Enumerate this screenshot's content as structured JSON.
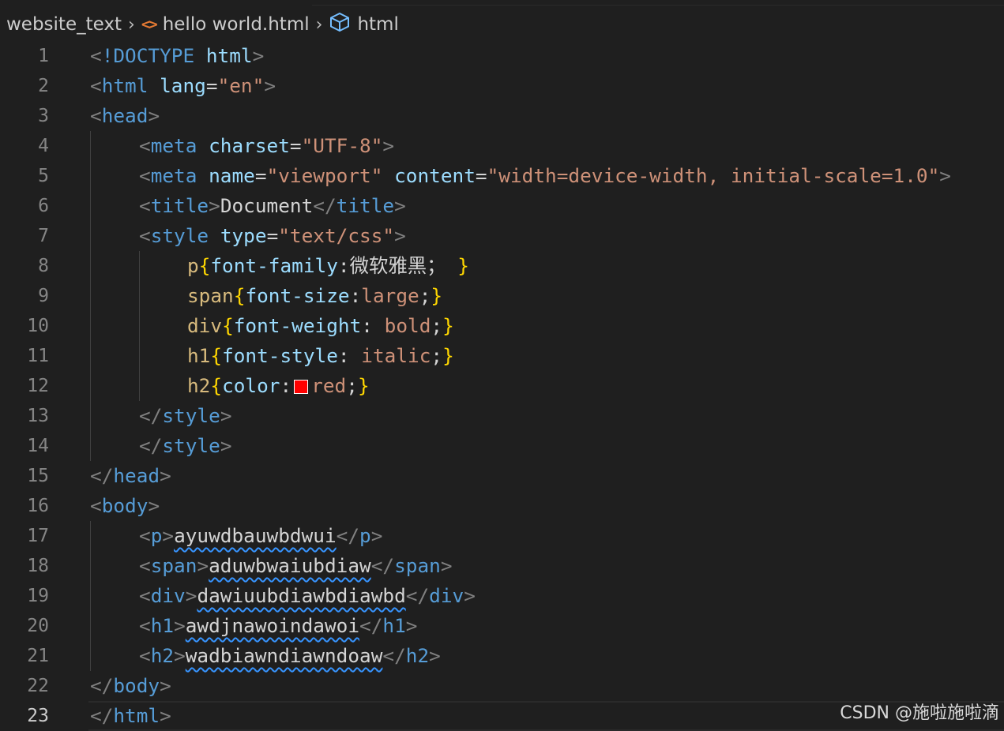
{
  "breadcrumb": {
    "folder": "website_text",
    "file": "hello world.html",
    "symbol": "html",
    "file_icon": "code-brackets-icon",
    "symbol_icon": "cube-icon"
  },
  "editor": {
    "active_line": 23,
    "colors": {
      "background": "#1f1f1f",
      "tag": "#569cd6",
      "attribute": "#9cdcfe",
      "string": "#ce9178",
      "selector": "#d7ba7d",
      "bracket": "#ffd700",
      "swatch": "#ff0000"
    },
    "lines": [
      {
        "n": "1",
        "indent": 0,
        "tokens": [
          [
            "p",
            "<"
          ],
          [
            "doc",
            "!DOCTYPE"
          ],
          [
            "ws",
            " "
          ],
          [
            "attr",
            "html"
          ],
          [
            "p",
            ">"
          ]
        ]
      },
      {
        "n": "2",
        "indent": 0,
        "tokens": [
          [
            "p",
            "<"
          ],
          [
            "tag",
            "html"
          ],
          [
            "ws",
            " "
          ],
          [
            "attr",
            "lang"
          ],
          [
            "txt",
            "="
          ],
          [
            "str",
            "\"en\""
          ],
          [
            "p",
            ">"
          ]
        ]
      },
      {
        "n": "3",
        "indent": 0,
        "tokens": [
          [
            "p",
            "<"
          ],
          [
            "tag",
            "head"
          ],
          [
            "p",
            ">"
          ]
        ]
      },
      {
        "n": "4",
        "indent": 1,
        "tokens": [
          [
            "p",
            "<"
          ],
          [
            "tag",
            "meta"
          ],
          [
            "ws",
            " "
          ],
          [
            "attr",
            "charset"
          ],
          [
            "txt",
            "="
          ],
          [
            "str",
            "\"UTF-8\""
          ],
          [
            "p",
            ">"
          ]
        ]
      },
      {
        "n": "5",
        "indent": 1,
        "tokens": [
          [
            "p",
            "<"
          ],
          [
            "tag",
            "meta"
          ],
          [
            "ws",
            " "
          ],
          [
            "attr",
            "name"
          ],
          [
            "txt",
            "="
          ],
          [
            "str",
            "\"viewport\""
          ],
          [
            "ws",
            " "
          ],
          [
            "attr",
            "content"
          ],
          [
            "txt",
            "="
          ],
          [
            "str",
            "\"width=device-width, initial-scale=1.0\""
          ],
          [
            "p",
            ">"
          ]
        ]
      },
      {
        "n": "6",
        "indent": 1,
        "tokens": [
          [
            "p",
            "<"
          ],
          [
            "tag",
            "title"
          ],
          [
            "p",
            ">"
          ],
          [
            "txt",
            "Document"
          ],
          [
            "p",
            "</"
          ],
          [
            "tag",
            "title"
          ],
          [
            "p",
            ">"
          ]
        ]
      },
      {
        "n": "7",
        "indent": 1,
        "tokens": [
          [
            "p",
            "<"
          ],
          [
            "tag",
            "style"
          ],
          [
            "ws",
            " "
          ],
          [
            "attr",
            "type"
          ],
          [
            "txt",
            "="
          ],
          [
            "str",
            "\"text/css\""
          ],
          [
            "p",
            ">"
          ]
        ]
      },
      {
        "n": "8",
        "indent": 2,
        "tokens": [
          [
            "sel",
            "p"
          ],
          [
            "br",
            "{"
          ],
          [
            "prop",
            "font-family"
          ],
          [
            "txt",
            ":"
          ],
          [
            "txt",
            "微软雅黑；"
          ],
          [
            "ws",
            " "
          ],
          [
            "br",
            "}"
          ]
        ]
      },
      {
        "n": "9",
        "indent": 2,
        "tokens": [
          [
            "sel",
            "span"
          ],
          [
            "br",
            "{"
          ],
          [
            "prop",
            "font-size"
          ],
          [
            "txt",
            ":"
          ],
          [
            "val",
            "large"
          ],
          [
            "txt",
            ";"
          ],
          [
            "br",
            "}"
          ]
        ]
      },
      {
        "n": "10",
        "indent": 2,
        "tokens": [
          [
            "sel",
            "div"
          ],
          [
            "br",
            "{"
          ],
          [
            "prop",
            "font-weight"
          ],
          [
            "txt",
            ":"
          ],
          [
            "ws",
            " "
          ],
          [
            "val",
            "bold"
          ],
          [
            "txt",
            ";"
          ],
          [
            "br",
            "}"
          ]
        ]
      },
      {
        "n": "11",
        "indent": 2,
        "tokens": [
          [
            "sel",
            "h1"
          ],
          [
            "br",
            "{"
          ],
          [
            "prop",
            "font-style"
          ],
          [
            "txt",
            ":"
          ],
          [
            "ws",
            " "
          ],
          [
            "val",
            "italic"
          ],
          [
            "txt",
            ";"
          ],
          [
            "br",
            "}"
          ]
        ]
      },
      {
        "n": "12",
        "indent": 2,
        "tokens": [
          [
            "sel",
            "h2"
          ],
          [
            "br",
            "{"
          ],
          [
            "prop",
            "color"
          ],
          [
            "txt",
            ":"
          ],
          [
            "swatch",
            ""
          ],
          [
            "val",
            "red"
          ],
          [
            "txt",
            ";"
          ],
          [
            "br",
            "}"
          ]
        ]
      },
      {
        "n": "13",
        "indent": 1,
        "tokens": [
          [
            "p",
            "</"
          ],
          [
            "tag",
            "style"
          ],
          [
            "p",
            ">"
          ]
        ]
      },
      {
        "n": "14",
        "indent": 1,
        "tokens": [
          [
            "p",
            "</"
          ],
          [
            "tag",
            "style"
          ],
          [
            "p",
            ">"
          ]
        ]
      },
      {
        "n": "15",
        "indent": 0,
        "tokens": [
          [
            "p",
            "</"
          ],
          [
            "tag",
            "head"
          ],
          [
            "p",
            ">"
          ]
        ]
      },
      {
        "n": "16",
        "indent": 0,
        "tokens": [
          [
            "p",
            "<"
          ],
          [
            "tag",
            "body"
          ],
          [
            "p",
            ">"
          ]
        ]
      },
      {
        "n": "17",
        "indent": 1,
        "tokens": [
          [
            "p",
            "<"
          ],
          [
            "tag",
            "p"
          ],
          [
            "p",
            ">"
          ],
          [
            "sq",
            "ayuwdbauwbdwui"
          ],
          [
            "p",
            "</"
          ],
          [
            "tag",
            "p"
          ],
          [
            "p",
            ">"
          ]
        ]
      },
      {
        "n": "18",
        "indent": 1,
        "tokens": [
          [
            "p",
            "<"
          ],
          [
            "tag",
            "span"
          ],
          [
            "p",
            ">"
          ],
          [
            "sq",
            "aduwbwaiubdiaw"
          ],
          [
            "p",
            "</"
          ],
          [
            "tag",
            "span"
          ],
          [
            "p",
            ">"
          ]
        ]
      },
      {
        "n": "19",
        "indent": 1,
        "tokens": [
          [
            "p",
            "<"
          ],
          [
            "tag",
            "div"
          ],
          [
            "p",
            ">"
          ],
          [
            "sq",
            "dawiuubdiawbdiawbd"
          ],
          [
            "p",
            "</"
          ],
          [
            "tag",
            "div"
          ],
          [
            "p",
            ">"
          ]
        ]
      },
      {
        "n": "20",
        "indent": 1,
        "tokens": [
          [
            "p",
            "<"
          ],
          [
            "tag",
            "h1"
          ],
          [
            "p",
            ">"
          ],
          [
            "sq",
            "awdjnawoindawoi"
          ],
          [
            "p",
            "</"
          ],
          [
            "tag",
            "h1"
          ],
          [
            "p",
            ">"
          ]
        ]
      },
      {
        "n": "21",
        "indent": 1,
        "tokens": [
          [
            "p",
            "<"
          ],
          [
            "tag",
            "h2"
          ],
          [
            "p",
            ">"
          ],
          [
            "sq",
            "wadbiawndiawndoaw"
          ],
          [
            "p",
            "</"
          ],
          [
            "tag",
            "h2"
          ],
          [
            "p",
            ">"
          ]
        ]
      },
      {
        "n": "22",
        "indent": 0,
        "tokens": [
          [
            "p",
            "</"
          ],
          [
            "tag",
            "body"
          ],
          [
            "p",
            ">"
          ]
        ]
      },
      {
        "n": "23",
        "indent": 0,
        "tokens": [
          [
            "p",
            "</"
          ],
          [
            "tag",
            "html"
          ],
          [
            "p",
            ">"
          ]
        ]
      }
    ]
  },
  "watermark": "CSDN @施啦施啦滴"
}
